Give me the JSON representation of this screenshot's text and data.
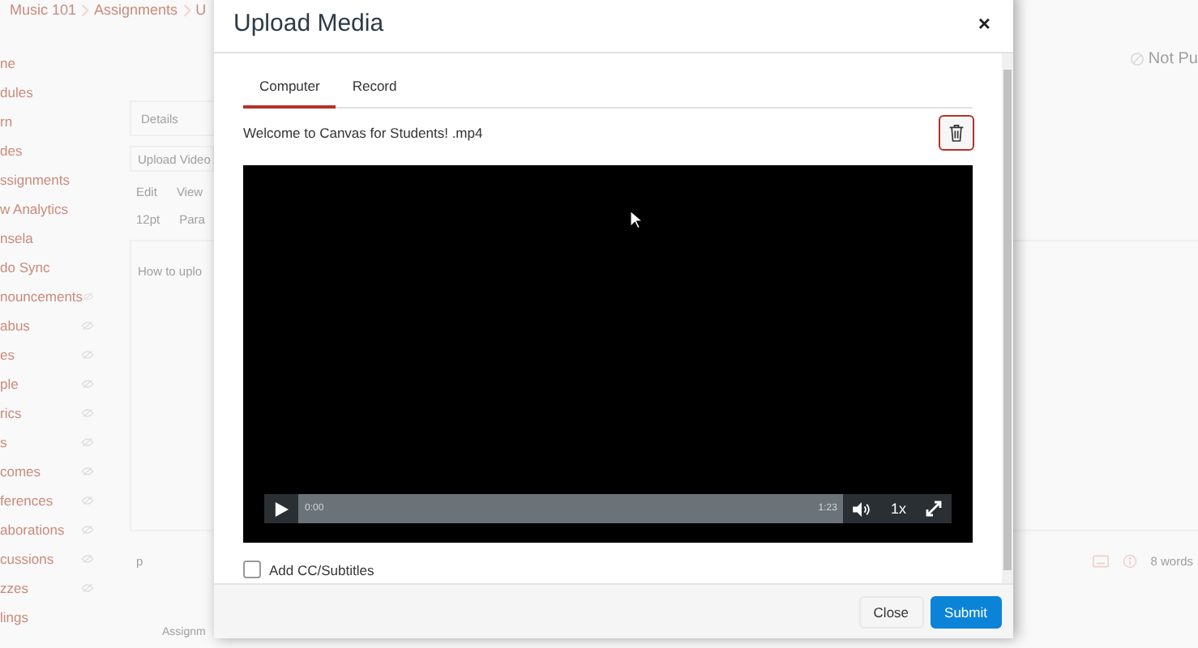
{
  "background": {
    "breadcrumb": [
      "Music 101",
      "Assignments",
      "U"
    ],
    "status": "Not Pu",
    "nav": [
      {
        "label": "ne",
        "eye": false
      },
      {
        "label": "dules",
        "eye": false
      },
      {
        "label": "rn",
        "eye": false
      },
      {
        "label": "des",
        "eye": false
      },
      {
        "label": "ssignments",
        "eye": false
      },
      {
        "label": "w Analytics",
        "eye": false
      },
      {
        "label": "nsela",
        "eye": false
      },
      {
        "label": "do Sync",
        "eye": false
      },
      {
        "label": "nouncements",
        "eye": true
      },
      {
        "label": "abus",
        "eye": true
      },
      {
        "label": "es",
        "eye": true
      },
      {
        "label": "ple",
        "eye": true
      },
      {
        "label": "rics",
        "eye": true
      },
      {
        "label": "s",
        "eye": true
      },
      {
        "label": "comes",
        "eye": true
      },
      {
        "label": "ferences",
        "eye": true
      },
      {
        "label": "aborations",
        "eye": true
      },
      {
        "label": "cussions",
        "eye": true
      },
      {
        "label": "zzes",
        "eye": true
      },
      {
        "label": "lings",
        "eye": false
      }
    ],
    "editor": {
      "tabs": [
        "Details"
      ],
      "title": "Upload Video",
      "menus": [
        "Edit",
        "View"
      ],
      "font_size": "12pt",
      "format": "Para",
      "body": "How to uplo",
      "path": "p",
      "word_count": "8 words"
    },
    "footer_text": "Assignm"
  },
  "modal": {
    "title": "Upload Media",
    "close": "×",
    "tabs": [
      {
        "label": "Computer",
        "selected": true
      },
      {
        "label": "Record",
        "selected": false
      }
    ],
    "file_name": "Welcome to Canvas for Students! .mp4",
    "player": {
      "current_time": "0:00",
      "duration": "1:23",
      "speed": "1x"
    },
    "cc": {
      "label": "Add CC/Subtitles",
      "checked": false
    },
    "buttons": [
      {
        "label": "Close",
        "kind": "secondary"
      },
      {
        "label": "Submit",
        "kind": "primary"
      }
    ]
  }
}
